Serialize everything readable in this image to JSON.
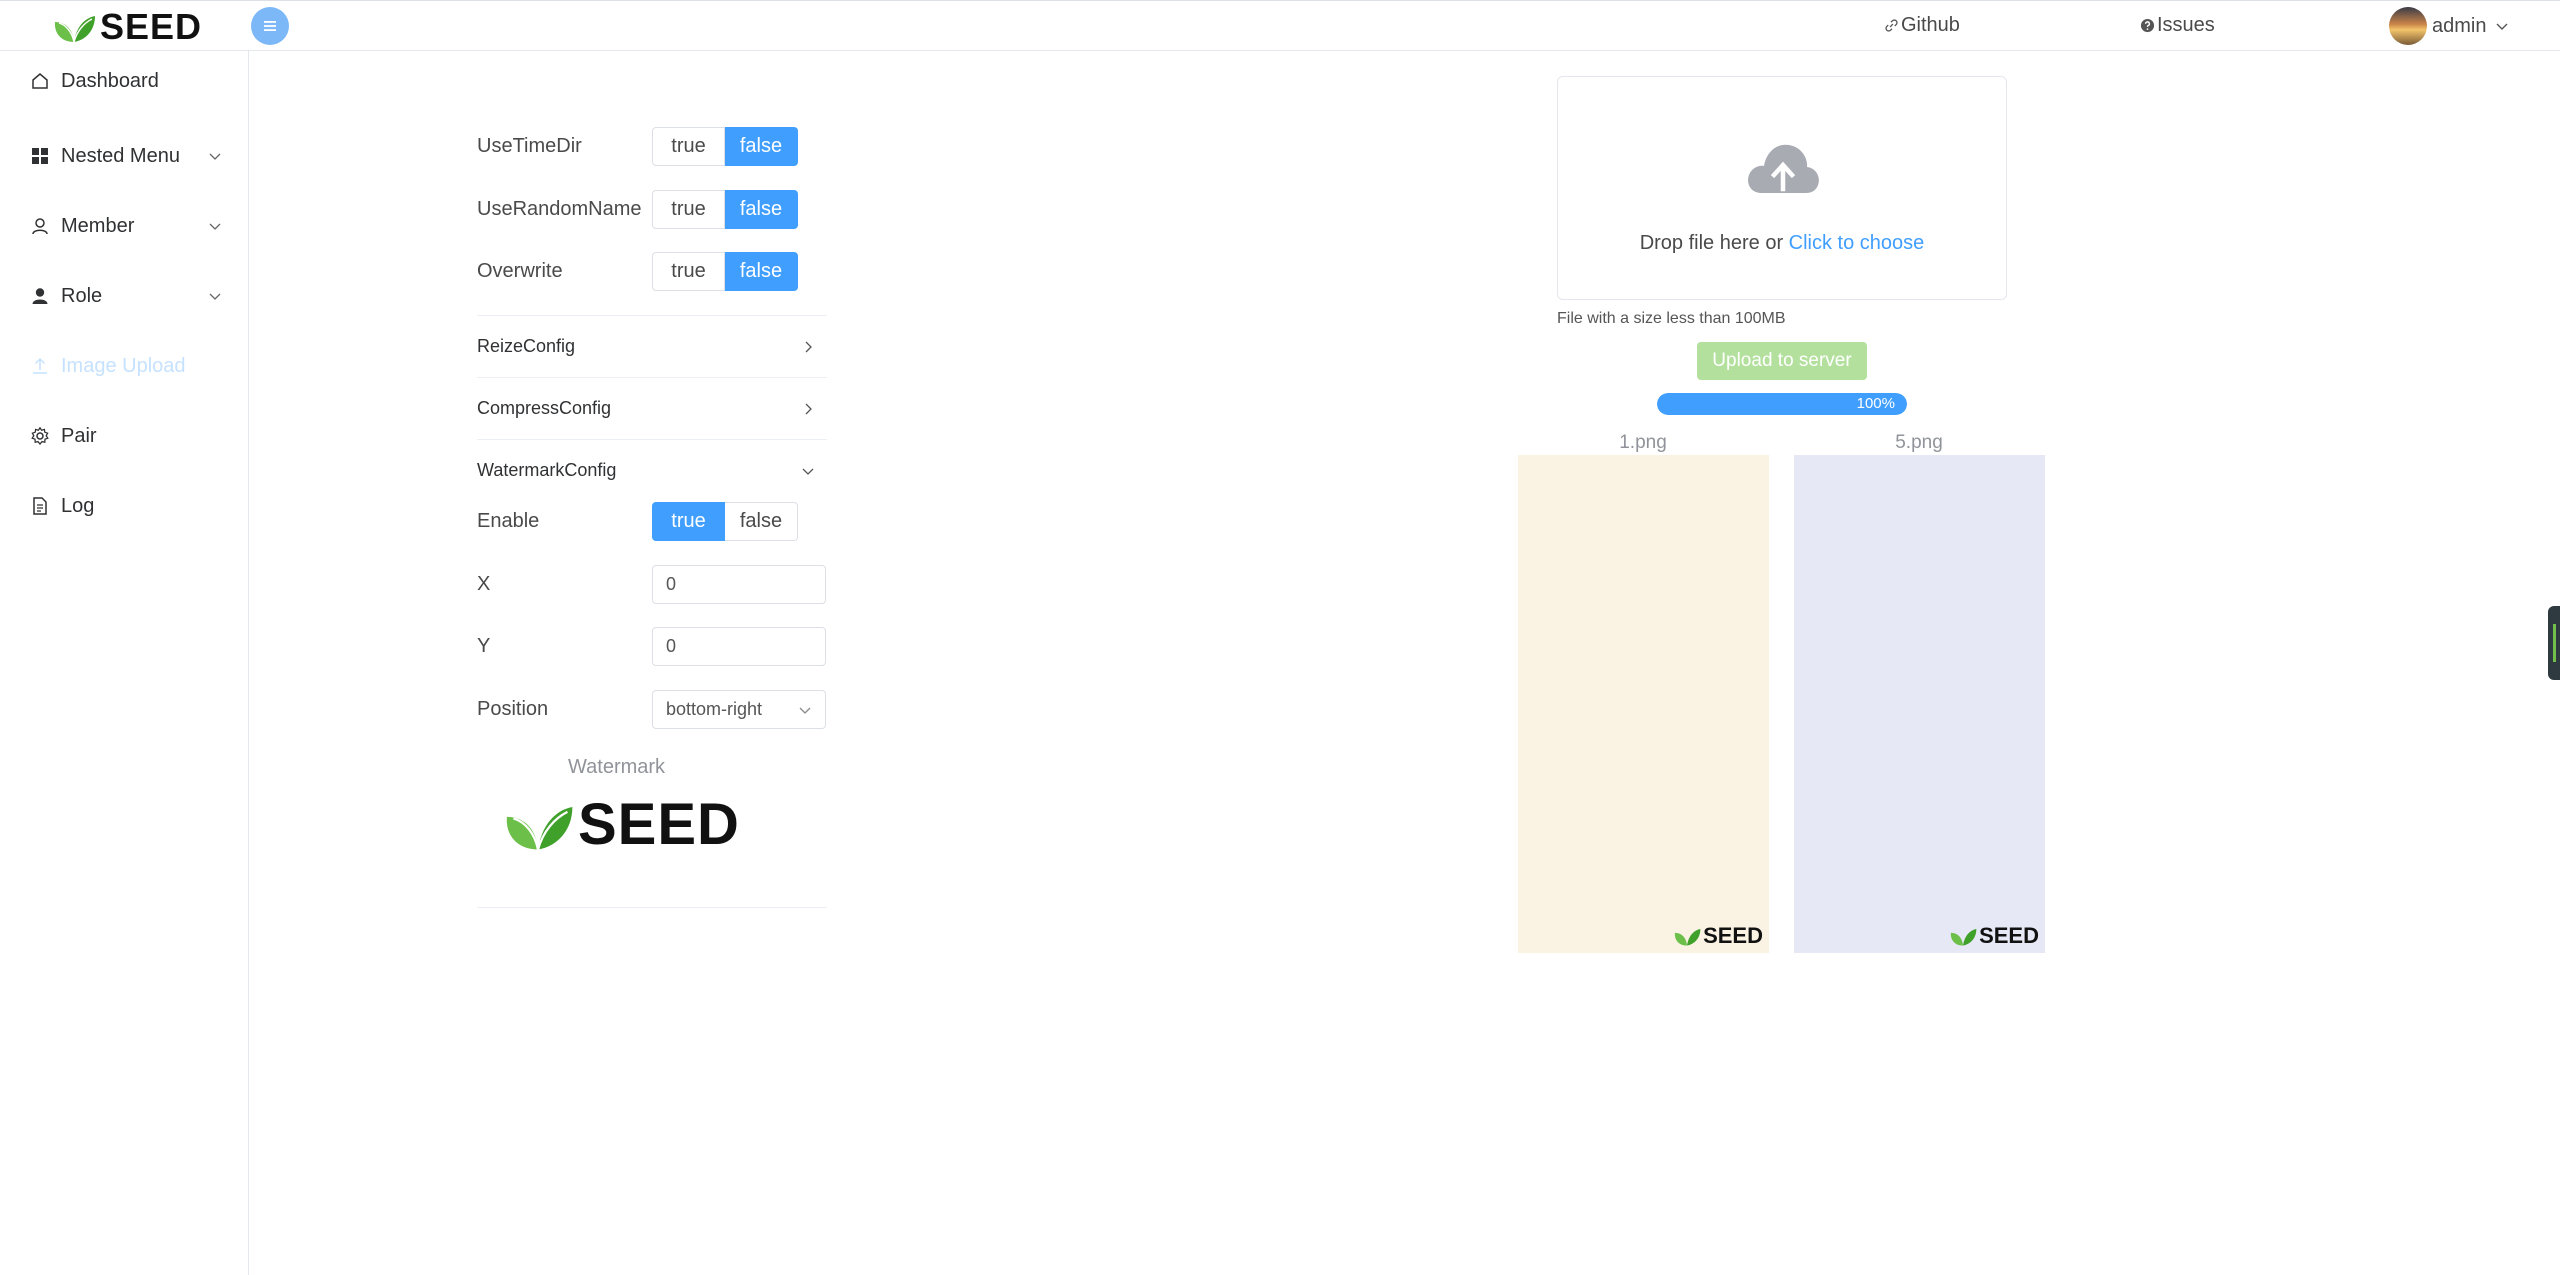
{
  "brand": {
    "name": "SEED"
  },
  "header": {
    "github_label": "Github",
    "issues_label": "Issues",
    "user_name": "admin"
  },
  "sidebar": {
    "items": [
      {
        "label": "Dashboard",
        "icon": "home-icon"
      },
      {
        "label": "Nested Menu",
        "icon": "grid-icon",
        "expandable": true
      },
      {
        "label": "Member",
        "icon": "user-icon",
        "expandable": true
      },
      {
        "label": "Role",
        "icon": "user-filled-icon",
        "expandable": true
      },
      {
        "label": "Image Upload",
        "icon": "upload-icon",
        "active": true
      },
      {
        "label": "Pair",
        "icon": "gear-icon"
      },
      {
        "label": "Log",
        "icon": "document-icon"
      }
    ]
  },
  "form": {
    "use_time_dir": {
      "label": "UseTimeDir",
      "options": [
        "true",
        "false"
      ],
      "selected": "false"
    },
    "use_random_name": {
      "label": "UseRandomName",
      "options": [
        "true",
        "false"
      ],
      "selected": "false"
    },
    "overwrite": {
      "label": "Overwrite",
      "options": [
        "true",
        "false"
      ],
      "selected": "false"
    },
    "sections": {
      "resize": "ReizeConfig",
      "compress": "CompressConfig",
      "watermark": "WatermarkConfig"
    },
    "watermark": {
      "enable": {
        "label": "Enable",
        "options": [
          "true",
          "false"
        ],
        "selected": "true"
      },
      "x": {
        "label": "X",
        "value": "0"
      },
      "y": {
        "label": "Y",
        "value": "0"
      },
      "position": {
        "label": "Position",
        "value": "bottom-right"
      },
      "preview_caption": "Watermark"
    }
  },
  "upload": {
    "drop_text": "Drop file here or ",
    "click_text": "Click to choose",
    "tip": "File with a size less than 100MB",
    "button_label": "Upload to server",
    "progress_text": "100%",
    "progress_value": 100,
    "files": [
      {
        "name": "1.png",
        "bg_color": "#faf3e3"
      },
      {
        "name": "5.png",
        "bg_color": "#e6e8f5"
      }
    ]
  },
  "colors": {
    "primary": "#409eff",
    "success_light": "#b3e19d",
    "leaf_green": "#5cb531"
  }
}
